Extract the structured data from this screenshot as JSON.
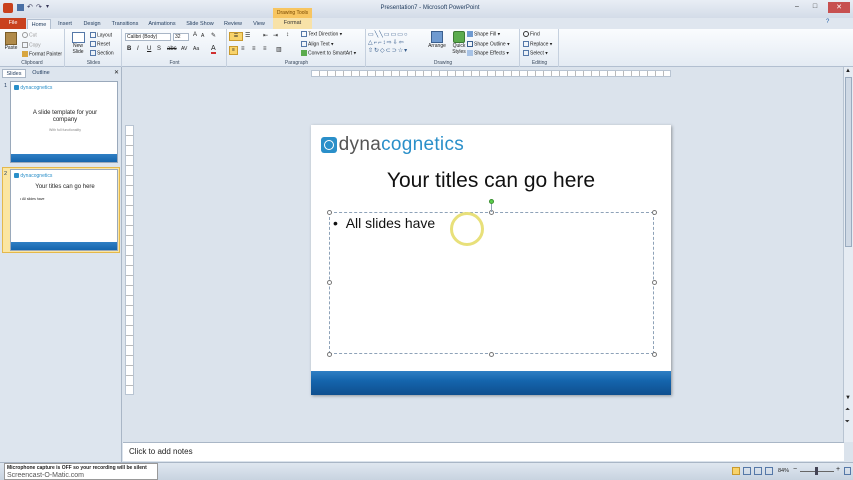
{
  "window": {
    "title": "Presentation7 - Microsoft PowerPoint",
    "context_tab_header": "Drawing Tools"
  },
  "tabs": [
    "File",
    "Home",
    "Insert",
    "Design",
    "Transitions",
    "Animations",
    "Slide Show",
    "Review",
    "View",
    "Format"
  ],
  "ribbon": {
    "clipboard": {
      "paste": "Paste",
      "cut": "Cut",
      "copy": "Copy",
      "format_painter": "Format Painter",
      "label": "Clipboard"
    },
    "slides": {
      "new_slide": "New Slide",
      "layout": "Layout",
      "reset": "Reset",
      "section": "Section",
      "label": "Slides"
    },
    "font": {
      "name": "Calibri (Body)",
      "size": "32",
      "label": "Font"
    },
    "paragraph": {
      "text_direction": "Text Direction",
      "align_text": "Align Text",
      "convert": "Convert to SmartArt",
      "label": "Paragraph"
    },
    "drawing": {
      "arrange": "Arrange",
      "quick_styles": "Quick Styles",
      "shape_fill": "Shape Fill",
      "shape_outline": "Shape Outline",
      "shape_effects": "Shape Effects",
      "label": "Drawing"
    },
    "editing": {
      "find": "Find",
      "replace": "Replace",
      "select": "Select",
      "label": "Editing"
    }
  },
  "left_pane": {
    "tabs": [
      "Slides",
      "Outline"
    ],
    "thumbs": [
      {
        "num": "1",
        "logo": "dynacognetics",
        "title": "A slide template for your company",
        "subtitle": "With full functionality"
      },
      {
        "num": "2",
        "logo": "dynacognetics",
        "title": "Your titles can go here",
        "bullet": "All slides have"
      }
    ]
  },
  "slide": {
    "logo_prefix": "dyna",
    "logo_suffix": "cognetics",
    "title": "Your titles can go here",
    "bullet": "All slides have"
  },
  "notes": {
    "placeholder": "Click to add notes"
  },
  "status": {
    "overlay_line1": "Microphone capture is OFF so your recording will be silent",
    "overlay_line2": "Screencast-O-Matic.com",
    "zoom": "84%"
  },
  "colors": {
    "file_tab": "#c9411e",
    "logo_dark": "#555555",
    "logo_accent": "#2a8fc9",
    "footer_bar": "#1565ad",
    "cursor_ring": "#e8e07a"
  }
}
